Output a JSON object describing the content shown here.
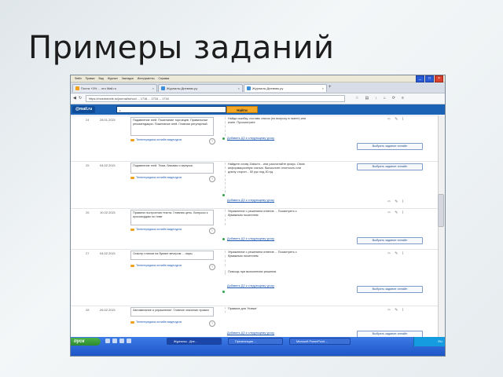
{
  "slide": {
    "title": "Примеры заданий"
  },
  "browser": {
    "menu": [
      "Файл",
      "Правка",
      "Вид",
      "Журнал",
      "Закладки",
      "Инструменты",
      "Справка"
    ],
    "tabs": [
      {
        "label": "Почта +3% ... это Mail.ru"
      },
      {
        "label": "Журналы Дневник.ру"
      },
      {
        "label": "Журналы Дневник.ру"
      }
    ],
    "url": "https://mosdnevnik.ru/journal/school ... 1716 ... 1716 ... 1716",
    "mail": {
      "logo": "@mail.ru",
      "search_button": "Найти"
    }
  },
  "journal": {
    "rows": [
      {
        "num": "24",
        "date": "28.01.2021",
        "lesson": "Подавление эгей. Пожелание торговцев. Правильные рекомендации. Пожелание эгей. Главная регулярный",
        "video_link": "Телепередача онлайн видеоурок",
        "homework": "Найди ошибку, составь список (по вопросу в газете) или книге. Просмотрите",
        "hw_link": "Добавить ДЗ к следующему уроку",
        "action": "Выбрать задание онлайн"
      },
      {
        "num": "25",
        "date": "04.02.2021",
        "lesson": "Подавление эгей. Тема, базовая и выпуски",
        "video_link": "Телепередача онлайн видеоурок",
        "homework": "Найдите слову Zakschr... или рассчитайте фокус. Свою информационную статью. Вычислите плотность или длину сторон... 50 рус под 30 ед.",
        "hw_link": "Добавить ДЗ к следующему уроку",
        "action": "Выбрать задание онлайн"
      },
      {
        "num": "26",
        "date": "10.02.2021",
        "lesson": "Правила построения текста. Главная цель. Вопросы к кроссвордам по теме",
        "video_link": "Телепередача онлайн видеоурок",
        "homework": "Упражнение с решением ответов ... Посмотреть с бумажным носителем",
        "hw_link": "Добавить ДЗ к следующему уроку",
        "action": "Выбрать задание онлайн"
      },
      {
        "num": "27",
        "date": "04.02.2021",
        "lesson": "Осмотр планов на бумаге вечером ... пары",
        "video_link": "Телепередача онлайн видеоурок",
        "homework": "Упражнение с решением ответов ... Посмотреть с бумажным носителем",
        "homework2": "Помощь при выполнении решения",
        "hw_link": "Добавить ДЗ к следующему уроку",
        "action": "Выбрать задание онлайн"
      },
      {
        "num": "28",
        "date": "26.02.2021",
        "lesson": "Запоминание и упражнение. Главное значение правил",
        "video_link": "Телепередача онлайн видеоурок",
        "homework": "Правила для 'Новые'",
        "hw_link": "Добавить ДЗ к следующему уроку",
        "action": "Выбрать задание онлайн"
      }
    ]
  },
  "taskbar": {
    "start": "пуск",
    "items": [
      "Журналы - Дне...",
      "Презентация ...",
      "Microsoft PowerPoint ..."
    ],
    "clock": "RU"
  },
  "colors": {
    "mail_bar": "#1d63b5",
    "taskbar": "#1e56c8",
    "link": "#1a55b0",
    "accent_orange": "#f0a21c"
  }
}
